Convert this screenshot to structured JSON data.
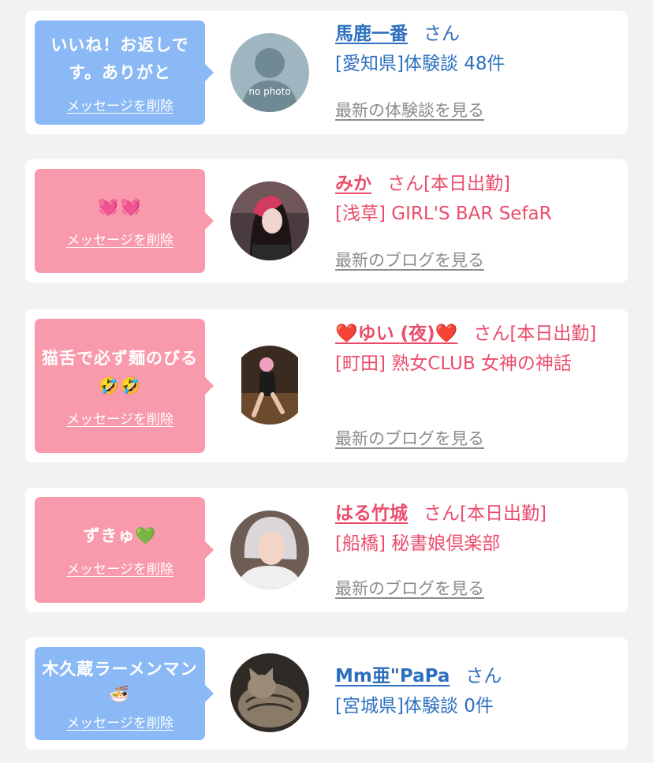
{
  "items": [
    {
      "message": "いいね！お返しです。ありがと",
      "delete_label": "メッセージを削除",
      "name": "馬鹿一番",
      "san": "さん",
      "area": "[愛知県]体験談 48件",
      "latest": "最新の体験談を見る",
      "avatar_text": "no photo",
      "color": "#2d6fbf"
    },
    {
      "message": "💓💓",
      "delete_label": "メッセージを削除",
      "name": "みか",
      "san": "さん[本日出勤]",
      "area": "[浅草] GIRL'S BAR SefaR",
      "latest": "最新のブログを見る",
      "color": "#ea4d6c"
    },
    {
      "message": "猫舌で必ず麺のびる🤣🤣",
      "delete_label": "メッセージを削除",
      "name": "❤️ゆい (夜)❤️",
      "san": "さん[本日出勤]",
      "area": "[町田] 熟女CLUB 女神の神話",
      "latest": "最新のブログを見る",
      "color": "#ea4d6c"
    },
    {
      "message": "ずきゅ💚",
      "delete_label": "メッセージを削除",
      "name": "はる竹城",
      "san": "さん[本日出勤]",
      "area": "[船橋] 秘書娘倶楽部",
      "latest": "最新のブログを見る",
      "color": "#ea4d6c"
    },
    {
      "message": "木久蔵ラーメンマン🍜",
      "delete_label": "メッセージを削除",
      "name": "Mm亜\"PaPa",
      "san": "さん",
      "area": "[宮城県]体験談 0件",
      "color": "#2d6fbf"
    }
  ]
}
